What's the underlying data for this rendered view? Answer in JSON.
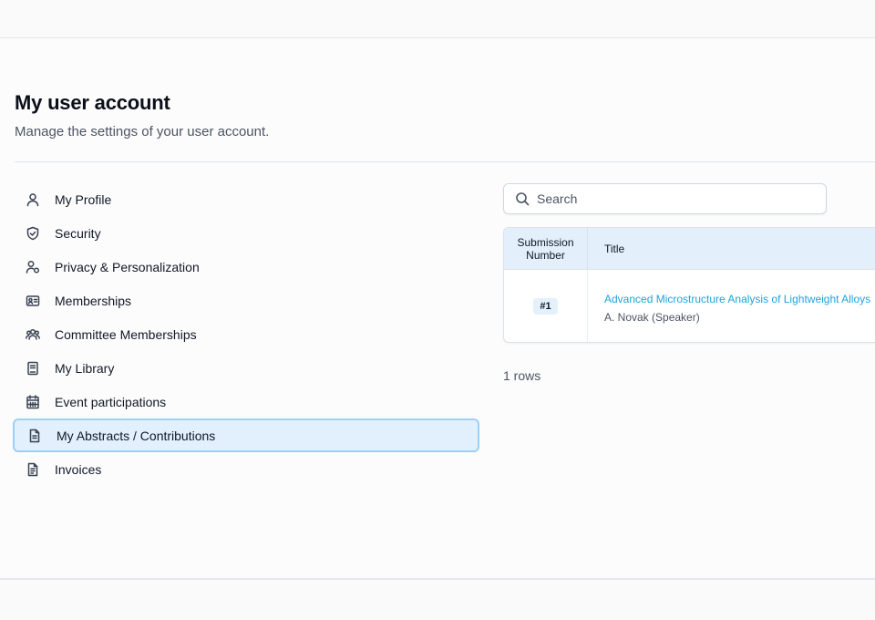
{
  "header": {
    "title": "My user account",
    "subtitle": "Manage the settings of your user account."
  },
  "sidebar": {
    "items": [
      {
        "label": "My Profile",
        "icon": "user-icon"
      },
      {
        "label": "Security",
        "icon": "shield-icon"
      },
      {
        "label": "Privacy & Personalization",
        "icon": "user-settings-icon"
      },
      {
        "label": "Memberships",
        "icon": "id-card-icon"
      },
      {
        "label": "Committee Memberships",
        "icon": "users-icon"
      },
      {
        "label": "My Library",
        "icon": "book-icon"
      },
      {
        "label": "Event participations",
        "icon": "calendar-icon"
      },
      {
        "label": "My Abstracts / Contributions",
        "icon": "document-icon",
        "active": true
      },
      {
        "label": "Invoices",
        "icon": "invoice-icon"
      }
    ]
  },
  "search": {
    "placeholder": "Search",
    "value": ""
  },
  "table": {
    "columns": [
      "Submission Number",
      "Title"
    ],
    "rows": [
      {
        "number": "#1",
        "title": "Advanced Microstructure Analysis of Lightweight Alloys",
        "author": "A. Novak (Speaker)"
      }
    ]
  },
  "footer": {
    "rows_count": "1 rows"
  },
  "colors": {
    "accent": "#1fa3dc",
    "active_bg": "#e1f0fc",
    "active_border": "#9fd0f2",
    "table_header_bg": "#e3f0fb"
  }
}
